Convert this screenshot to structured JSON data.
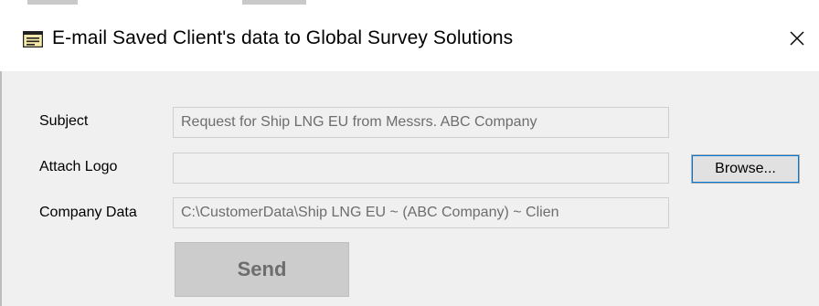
{
  "window": {
    "title": "E-mail Saved Client's data to Global Survey Solutions",
    "icon": "form-icon",
    "close_icon": "close-icon"
  },
  "form": {
    "subject": {
      "label": "Subject",
      "value": "Request for Ship LNG EU from Messrs. ABC Company"
    },
    "attach_logo": {
      "label": "Attach Logo",
      "value": ""
    },
    "company_data": {
      "label": "Company Data",
      "value": "C:\\CustomerData\\Ship LNG EU ~ (ABC Company) ~ Clien"
    },
    "browse_label": "Browse...",
    "send_label": "Send"
  },
  "colors": {
    "titlebar_bg": "#ffffff",
    "client_bg": "#f0f0f0",
    "focus_outline": "#0078d7",
    "disabled_text": "#6d6d6d"
  }
}
